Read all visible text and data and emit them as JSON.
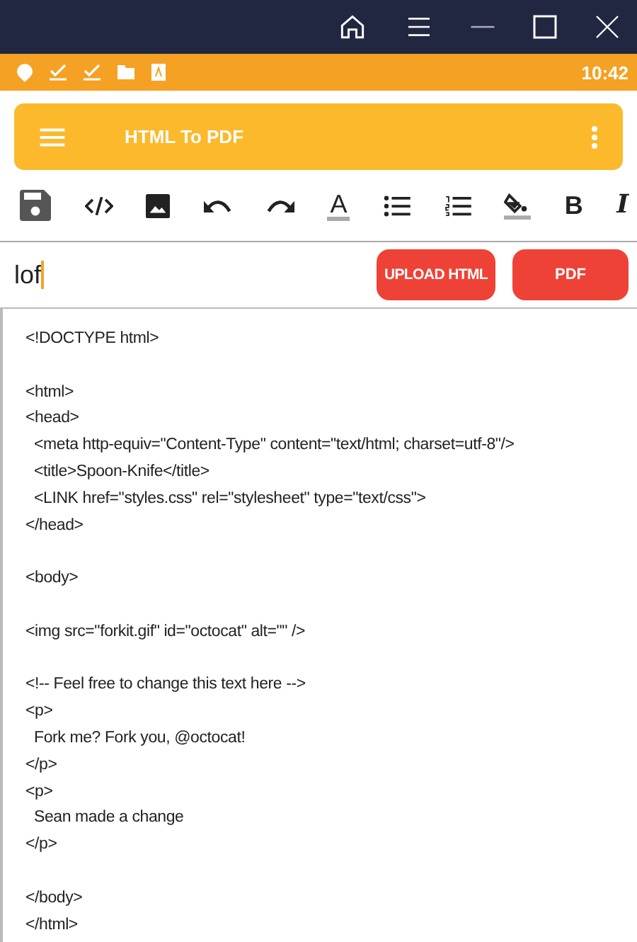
{
  "status_bar": {
    "time": "10:42"
  },
  "app_bar": {
    "title": "HTML To PDF"
  },
  "toolbar": [
    {
      "kind": "save"
    },
    {
      "kind": "code"
    },
    {
      "kind": "image"
    },
    {
      "kind": "undo"
    },
    {
      "kind": "redo"
    },
    {
      "kind": "text-color",
      "glyph": "A"
    },
    {
      "kind": "bullets"
    },
    {
      "kind": "numbers"
    },
    {
      "kind": "fill"
    },
    {
      "kind": "bold",
      "glyph": "B"
    },
    {
      "kind": "italic",
      "glyph": "I"
    }
  ],
  "file_field": {
    "value": "lof"
  },
  "buttons": [
    "UPLOAD HTML",
    "PDF"
  ],
  "code_blocks": [
    [
      {
        "text": "<!DOCTYPE html>",
        "indented": false
      }
    ],
    [
      {
        "text": "<html>",
        "indented": false
      },
      {
        "text": "<head>",
        "indented": false
      },
      {
        "text": "<meta http-equiv=\"Content-Type\" content=\"text/html; charset=utf-8\"/>",
        "indented": true
      },
      {
        "text": "<title>Spoon-Knife</title>",
        "indented": true
      },
      {
        "text": "<LINK href=\"styles.css\" rel=\"stylesheet\" type=\"text/css\">",
        "indented": true
      },
      {
        "text": "</head>",
        "indented": false
      }
    ],
    [
      {
        "text": "<body>",
        "indented": false
      }
    ],
    [
      {
        "text": "<img src=\"forkit.gif\" id=\"octocat\" alt=\"\" />",
        "indented": false
      }
    ],
    [
      {
        "text": "<!-- Feel free to change this text here -->",
        "indented": false
      },
      {
        "text": "<p>",
        "indented": false
      },
      {
        "text": "Fork me? Fork you, @octocat!",
        "indented": true
      },
      {
        "text": "</p>",
        "indented": false
      },
      {
        "text": "<p>",
        "indented": false
      },
      {
        "text": "Sean made a change",
        "indented": true
      },
      {
        "text": "</p>",
        "indented": false
      }
    ],
    [
      {
        "text": "</body>",
        "indented": false
      },
      {
        "text": "</html>",
        "indented": false
      }
    ]
  ]
}
